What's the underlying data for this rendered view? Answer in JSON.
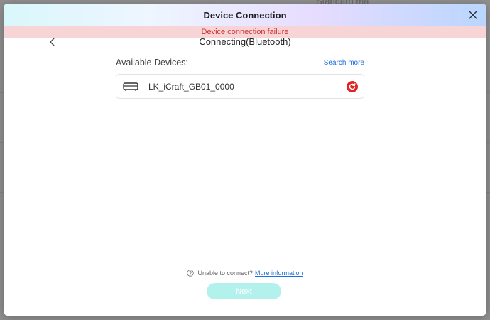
{
  "dialog": {
    "title": "Device Connection",
    "error_message": "Device connection failure",
    "step_title": "Connecting(Bluetooth)"
  },
  "devices": {
    "label": "Available Devices:",
    "search_more": "Search more",
    "items": [
      {
        "name": "LK_iCraft_GB01_0000",
        "icon": "machine-icon",
        "status": "failed"
      }
    ]
  },
  "help": {
    "question": "Unable to connect?",
    "link": "More information"
  },
  "actions": {
    "next_label": "Next",
    "next_enabled": false
  },
  "colors": {
    "error_bg": "#f7d4d6",
    "error_text": "#d32f2f",
    "link": "#1e6fd9",
    "next_disabled": "#b3f2ec",
    "retry": "#e02424"
  },
  "background": {
    "text": "Standard ma"
  }
}
